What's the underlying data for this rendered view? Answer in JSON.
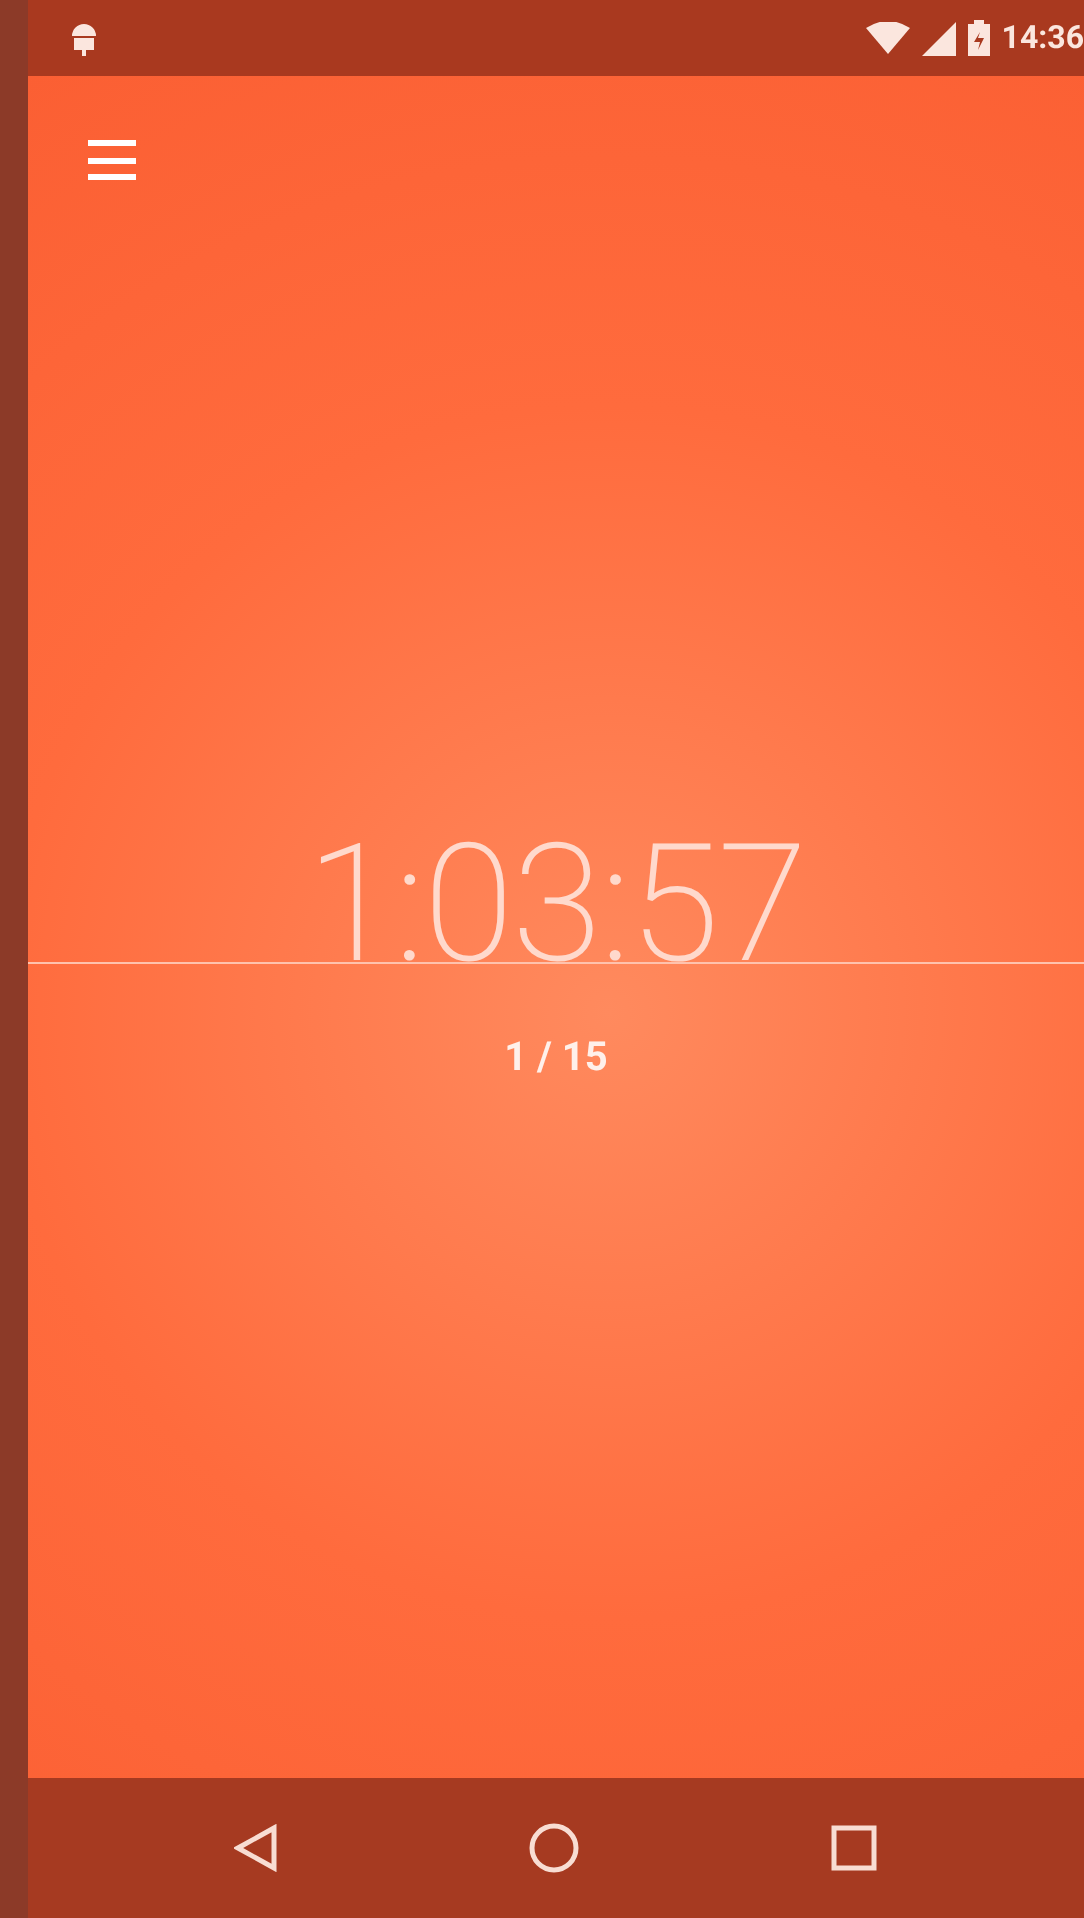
{
  "status_bar": {
    "time": "14:36"
  },
  "timer": {
    "time": "1:03:57",
    "counter": "1 / 15"
  }
}
